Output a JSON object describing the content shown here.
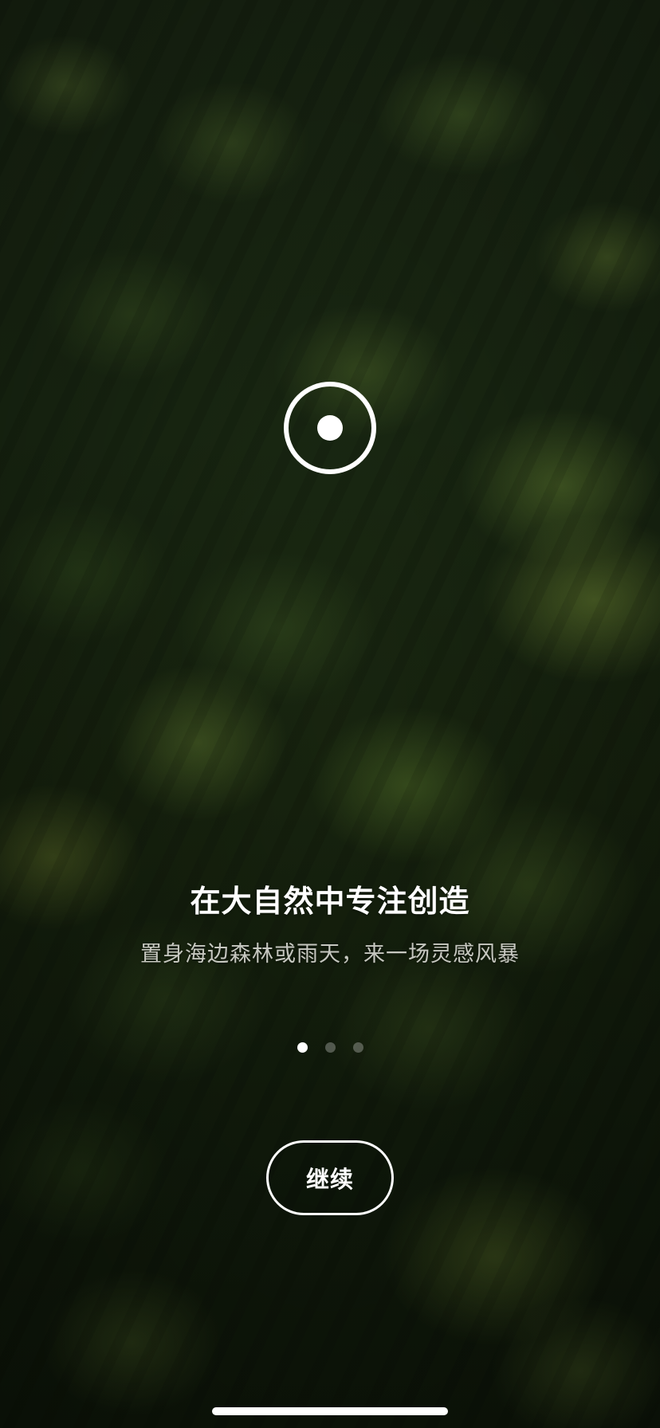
{
  "onboarding": {
    "headline": "在大自然中专注创造",
    "subline": "置身海边森林或雨天，来一场灵感风暴",
    "page_indicator": {
      "total": 3,
      "current": 1
    },
    "continue_label": "继续"
  },
  "theme": {
    "text_color": "#ffffff",
    "background": "aerial-forest-photo"
  },
  "icons": {
    "logo": "focus-target-icon"
  }
}
